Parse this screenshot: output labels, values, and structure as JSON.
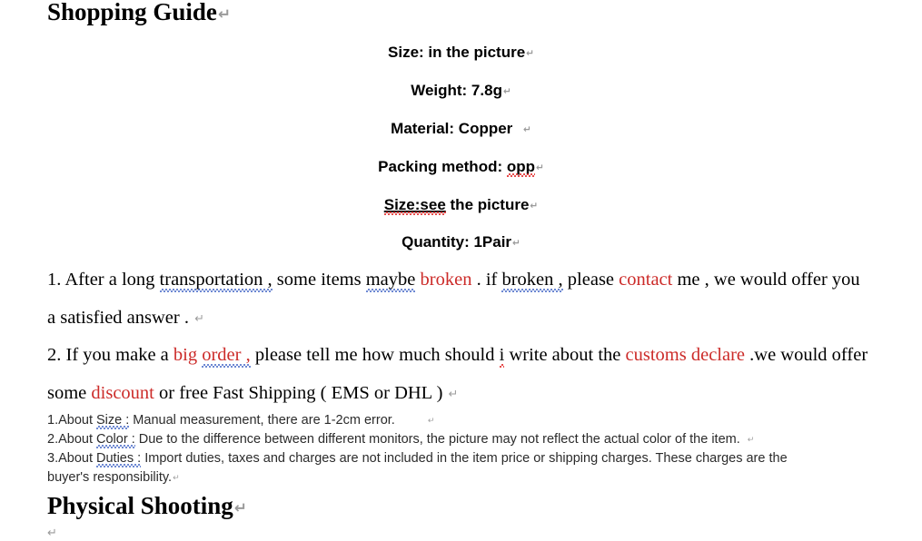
{
  "document": {
    "title": "Shopping Guide",
    "footer_heading": "Physical Shooting",
    "return_mark": "↵"
  },
  "specs": [
    {
      "label": "Size:",
      "value": " in the picture",
      "spell_error": false
    },
    {
      "label": "Weight:",
      "value": " 7.8g",
      "spell_error": false
    },
    {
      "label": "Material:",
      "value": " Copper ",
      "spell_error": false
    },
    {
      "label": "Packing method:",
      "value": " opp",
      "spell_error": true,
      "error_word": "opp"
    },
    {
      "label": "Size:see",
      "value": " the picture",
      "spell_error": true,
      "error_word": "Size:see",
      "underlined": true
    },
    {
      "label": "Quantity:",
      "value": " 1Pair",
      "spell_error": false
    }
  ],
  "spec_lines": {
    "size": "Size: in the picture",
    "weight": "Weight: 7.8g",
    "material": "Material: Copper ",
    "packing_prefix": "Packing method: ",
    "packing_value": "opp",
    "size_see_value": "Size:see",
    "size_see_rest": " the picture",
    "quantity": "Quantity: 1Pair"
  },
  "paragraph1": {
    "line1": {
      "seg1": "1. After a long ",
      "seg2_grammar": "transportation ,",
      "seg3": " some items ",
      "seg4_grammar": "maybe",
      "seg5": " ",
      "seg6_red": "broken",
      "seg7": " . if ",
      "seg8_grammar": "broken ,",
      "seg9": " please ",
      "seg10_red": "contact",
      "seg11": " me , we would offer you"
    },
    "line2": "a satisfied answer . "
  },
  "paragraph2": {
    "line1": {
      "seg1": "2. If you make a ",
      "seg2_red": "big ",
      "seg3_red_grammar": "order ,",
      "seg4": " please tell me how much should ",
      "seg5_spell": "i",
      "seg6": " write about the ",
      "seg7_red": "customs declare",
      "seg8": " .we would offer"
    },
    "line2": {
      "seg1": "some ",
      "seg2_red": "discount",
      "seg3": " or free Fast Shipping ( EMS or DHL ) "
    }
  },
  "notes": [
    {
      "index": "1.About ",
      "term": "Size :",
      "text": " Manual measurement, there are 1-2cm error.",
      "has_return": true
    },
    {
      "index": "2.About ",
      "term": "Color :",
      "text": " Due to the difference between different monitors, the picture may not reflect the actual color of the item. ",
      "has_return": true
    },
    {
      "index": "3.About ",
      "term": "Duties :",
      "text": " Import duties, taxes and charges are not included in the item price or shipping charges. These charges are the",
      "has_return": false
    }
  ],
  "notes_wrap_line": "buyer's responsibility.",
  "colors": {
    "highlight_red": "#CC2B29",
    "spell_underline_red": "#e02020",
    "grammar_underline_blue": "#4A6BC8",
    "return_mark_gray": "#9a9a9a",
    "body_text": "#000000",
    "note_text": "#2b2b2b",
    "background": "#ffffff"
  }
}
